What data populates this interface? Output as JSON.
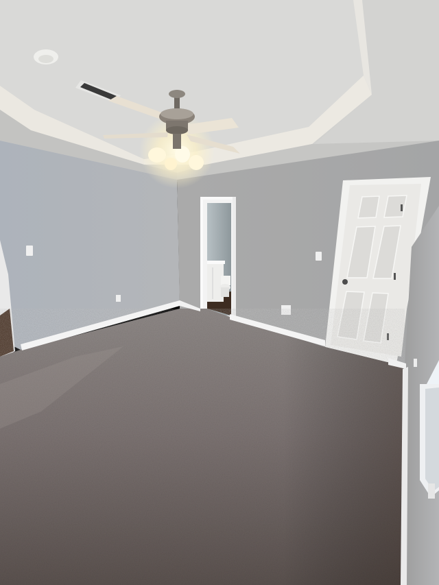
{
  "scene": {
    "description_colors": {
      "ceiling": "#d9d9d7",
      "ceiling_shadow": "#c4c4c2",
      "tray_trim": "#ece9e2",
      "wall_left": "#b7bac0",
      "wall_back": "#a9abad",
      "wall_right": "#a2a4a6",
      "baseboard": "#f2f2f2",
      "door": "#ecebe8",
      "carpet_light": "#8d8786",
      "carpet_dark": "#5f5653",
      "bathroom_wall": "#9fa9ad",
      "bathroom_floor": "#3d2d22",
      "fan_blade": "#e7dfd0",
      "fan_metal": "#7b756d",
      "light_glow": "#fff6d6"
    },
    "objects": [
      "ceiling-fan",
      "tray-ceiling",
      "air-vent",
      "smoke-detector",
      "closet-door",
      "bathroom-doorway",
      "toilet",
      "vanity",
      "light-switch",
      "outlet",
      "window",
      "carpet-floor"
    ]
  }
}
